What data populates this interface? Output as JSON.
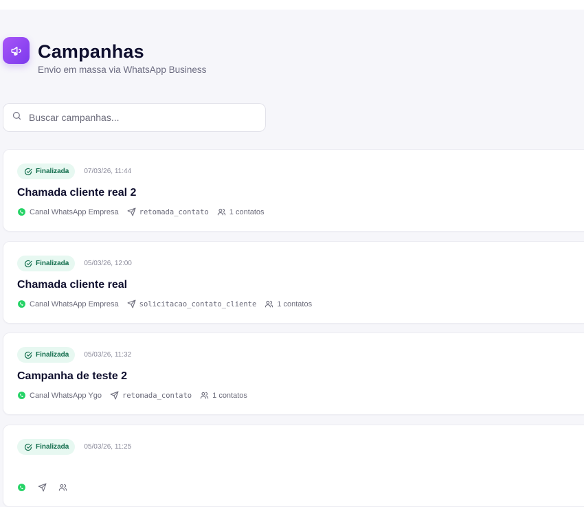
{
  "header": {
    "title": "Campanhas",
    "subtitle": "Envio em massa via WhatsApp Business",
    "icon": "megaphone-icon",
    "accent": "#7c3aed"
  },
  "search": {
    "placeholder": "Buscar campanhas...",
    "value": ""
  },
  "status_colors": {
    "finalizada_bg": "#e7f8f1",
    "finalizada_text": "#0f6b4a"
  },
  "campaigns": [
    {
      "status": "Finalizada",
      "date": "07/03/26, 11:44",
      "title": "Chamada cliente real 2",
      "channel": "Canal WhatsApp Empresa",
      "template": "retomada_contato",
      "contacts": "1 contatos"
    },
    {
      "status": "Finalizada",
      "date": "05/03/26, 12:00",
      "title": "Chamada cliente real",
      "channel": "Canal WhatsApp Empresa",
      "template": "solicitacao_contato_cliente",
      "contacts": "1 contatos"
    },
    {
      "status": "Finalizada",
      "date": "05/03/26, 11:32",
      "title": "Campanha de teste 2",
      "channel": "Canal WhatsApp Ygo",
      "template": "retomada_contato",
      "contacts": "1 contatos"
    },
    {
      "status": "Finalizada",
      "date": "05/03/26, 11:25",
      "title": "",
      "channel": "",
      "template": "",
      "contacts": ""
    }
  ]
}
